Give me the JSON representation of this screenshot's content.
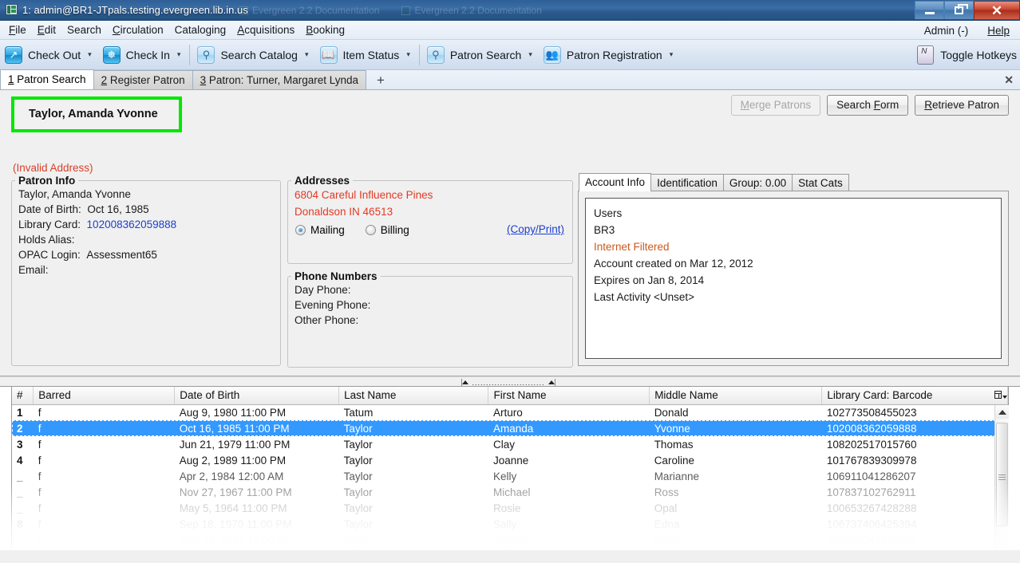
{
  "window": {
    "title": "1: admin@BR1-JTpals.testing.evergreen.lib.in.us",
    "bg_windows": [
      "Evergreen 2.2 Documentation",
      "Evergreen 2.2 Documentation"
    ],
    "minimize": "–",
    "maximize": "❐",
    "close": "✕"
  },
  "menubar": {
    "items": [
      {
        "pre": "F",
        "rest": "ile"
      },
      {
        "pre": "E",
        "rest": "dit"
      },
      {
        "pre": "S",
        "rest": "earch"
      },
      {
        "pre": "C",
        "rest": "irculation"
      },
      {
        "pre": "C",
        "rest": "ataloging"
      },
      {
        "pre": "A",
        "rest": "cquisitions"
      },
      {
        "pre": "B",
        "rest": "ooking"
      }
    ],
    "admin": "Admin (-)",
    "help": "Help"
  },
  "toolbar": {
    "items": [
      {
        "label": "Check Out",
        "icon": "check-out-icon",
        "glyph": "↗",
        "style": "blue",
        "caret": true
      },
      {
        "label": "Check In",
        "icon": "check-in-icon",
        "glyph": "✥",
        "style": "blue",
        "caret": true
      },
      {
        "label": "Search Catalog",
        "icon": "search-catalog-icon",
        "glyph": "⚲",
        "style": "pale",
        "caret": true
      },
      {
        "label": "Item Status",
        "icon": "item-status-icon",
        "glyph": "▤",
        "style": "pale",
        "caret": true
      },
      {
        "label": "Patron Search",
        "icon": "patron-search-icon",
        "glyph": "⚲",
        "style": "pale",
        "caret": true
      },
      {
        "label": "Patron Registration",
        "icon": "patron-registration-icon",
        "glyph": "὆5",
        "style": "pale",
        "caret": true
      }
    ],
    "toggle_hotkeys": "Toggle Hotkeys",
    "hotkey_icon_letter": "N"
  },
  "tabs": {
    "items": [
      {
        "num": "1",
        "label": " Patron Search",
        "active": true
      },
      {
        "num": "2",
        "label": " Register Patron",
        "active": false
      },
      {
        "num": "3",
        "label": " Patron: Turner, Margaret Lynda",
        "active": false
      }
    ],
    "add": "+",
    "close": "✕"
  },
  "patron": {
    "display_name": "Taylor, Amanda Yvonne",
    "invalid_address": "(Invalid Address)",
    "buttons": {
      "merge": {
        "pre": "M",
        "rest": "erge Patrons",
        "disabled": true
      },
      "search_form_pre": "Search ",
      "search_form_key": "F",
      "search_form_rest": "orm",
      "retrieve_pre": "R",
      "retrieve_rest": "etrieve Patron"
    },
    "info": {
      "legend": "Patron Info",
      "name": "Taylor, Amanda Yvonne",
      "dob_label": "Date of Birth:",
      "dob_value": "Oct 16, 1985",
      "card_label": "Library Card:",
      "card_value": "102008362059888",
      "holds_alias_label": "Holds Alias:",
      "holds_alias_value": "",
      "opac_login_label": "OPAC Login:",
      "opac_login_value": "Assessment65",
      "email_label": "Email:",
      "email_value": ""
    },
    "addresses": {
      "legend": "Addresses",
      "street": "6804 Careful Influence Pines",
      "citystatezip": "Donaldson   IN   46513",
      "mailing_label": "Mailing",
      "billing_label": "Billing",
      "mailing_selected": true,
      "copy_print": "(Copy/Print)"
    },
    "phones": {
      "legend": "Phone Numbers",
      "day_label": "Day Phone:",
      "day_value": "",
      "evening_label": "Evening Phone:",
      "evening_value": "",
      "other_label": "Other Phone:",
      "other_value": ""
    },
    "right_tabs": [
      {
        "label": "Account Info",
        "active": true
      },
      {
        "label": "Identification",
        "active": false
      },
      {
        "label": "Group: 0.00",
        "active": false
      },
      {
        "label": "Stat Cats",
        "active": false
      }
    ],
    "account_info": [
      {
        "text": "Users",
        "warn": false
      },
      {
        "text": "BR3",
        "warn": false
      },
      {
        "text": "Internet Filtered",
        "warn": true
      },
      {
        "text": "Account created on Mar 12, 2012",
        "warn": false
      },
      {
        "text": "Expires on Jan 8, 2014",
        "warn": false
      },
      {
        "text": "Last Activity <Unset>",
        "warn": false
      }
    ]
  },
  "results": {
    "columns": [
      "#",
      "Barred",
      "Date of Birth",
      "Last Name",
      "First Name",
      "Middle Name",
      "Library Card: Barcode"
    ],
    "rows": [
      {
        "num": "1",
        "barred": "f",
        "dob": "Aug 9, 1980 11:00 PM",
        "last": "Tatum",
        "first": "Arturo",
        "middle": "Donald",
        "barcode": "102773508455023",
        "selected": false
      },
      {
        "num": "2",
        "barred": "f",
        "dob": "Oct 16, 1985 11:00 PM",
        "last": "Taylor",
        "first": "Amanda",
        "middle": "Yvonne",
        "barcode": "102008362059888",
        "selected": true
      },
      {
        "num": "3",
        "barred": "f",
        "dob": "Jun 21, 1979 11:00 PM",
        "last": "Taylor",
        "first": "Clay",
        "middle": "Thomas",
        "barcode": "108202517015760",
        "selected": false
      },
      {
        "num": "4",
        "barred": "f",
        "dob": "Aug 2, 1989 11:00 PM",
        "last": "Taylor",
        "first": "Joanne",
        "middle": "Caroline",
        "barcode": "101767839309978",
        "selected": false
      },
      {
        "num": "_",
        "barred": "f",
        "dob": "Apr 2, 1984 12:00 AM",
        "last": "Taylor",
        "first": "Kelly",
        "middle": "Marianne",
        "barcode": "106911041286207",
        "selected": false
      },
      {
        "num": "_",
        "barred": "f",
        "dob": "Nov 27, 1967 11:00 PM",
        "last": "Taylor",
        "first": "Michael",
        "middle": "Ross",
        "barcode": "107837102762911",
        "selected": false
      },
      {
        "num": "_",
        "barred": "f",
        "dob": "May 5, 1964 11:00 PM",
        "last": "Taylor",
        "first": "Rosie",
        "middle": "Opal",
        "barcode": "100653267428288",
        "selected": false
      },
      {
        "num": "8",
        "barred": "f",
        "dob": "Sep 18, 1970 11:00 PM",
        "last": "Taylor",
        "first": "Sally",
        "middle": "Edna",
        "barcode": "106737406425394",
        "selected": false
      },
      {
        "num": "",
        "barred": "f",
        "dob": "May 15, 1997 11:00 PM",
        "last": "Taylor",
        "first": "Virginia",
        "middle": "Karen",
        "barcode": "105979041890123",
        "selected": false
      }
    ]
  },
  "colors": {
    "highlight_box": "#00e800",
    "selection": "#3399ff",
    "error_text": "#e33a24",
    "link": "#1a3fd0",
    "warn_text": "#c85a20"
  }
}
